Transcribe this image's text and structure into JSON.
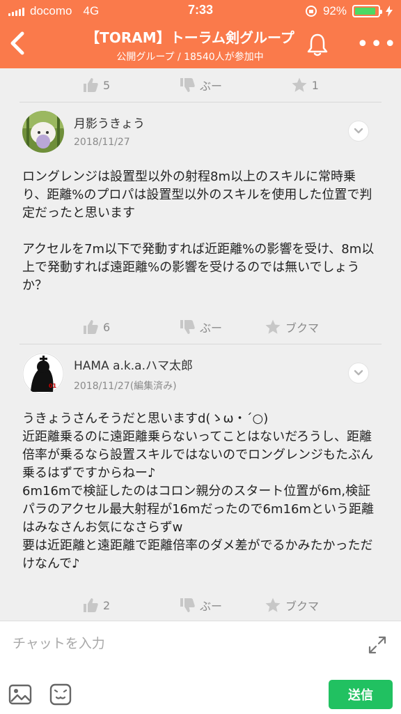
{
  "status": {
    "carrier": "docomo",
    "network": "4G",
    "time": "7:33",
    "battery": "92%",
    "battery_level": 0.92
  },
  "header": {
    "title": "【TORAM】トーラム剣グループ",
    "subtitle": "公開グループ / 18540人が参加中"
  },
  "top_reactions": {
    "likes": "5",
    "boo": "ぶー",
    "stars": "1"
  },
  "posts": [
    {
      "author": "月影うきょう",
      "date": "2018/11/27",
      "body": "ロングレンジは設置型以外の射程8m以上のスキルに常時乗り、距離%のプロパは設置型以外のスキルを使用した位置で判定だったと思います\n\nアクセルを7m以下で発動すれば近距離%の影響を受け、8m以上で発動すれば遠距離%の影響を受けるのでは無いでしょうか？",
      "likes": "6",
      "boo": "ぶー",
      "bookmark": "ブクマ"
    },
    {
      "author": "HAMA a.k.a.ハマ太郎",
      "date": "2018/11/27(編集済み)",
      "body": "うきょうさんそうだと思いますd(ゝω・´○)\n近距離乗るのに遠距離乗らないってことはないだろうし、距離倍率が乗るなら設置スキルではないのでロングレンジもたぶん乗るはずですからねー♪\n6m16mで検証したのはコロン親分のスタート位置が6m,検証パラのアクセル最大射程が16mだったので6m16mという距離はみなさんお気になさらずw\n要は近距離と遠距離で距離倍率のダメ差がでるかみたかっただけなんで♪",
      "likes": "2",
      "boo": "ぶー",
      "bookmark": "ブクマ"
    }
  ],
  "composer": {
    "placeholder": "チャットを入力",
    "send_label": "送信"
  },
  "colors": {
    "header": "#fa7a4b",
    "send": "#21c161",
    "battery": "#4cd964"
  }
}
